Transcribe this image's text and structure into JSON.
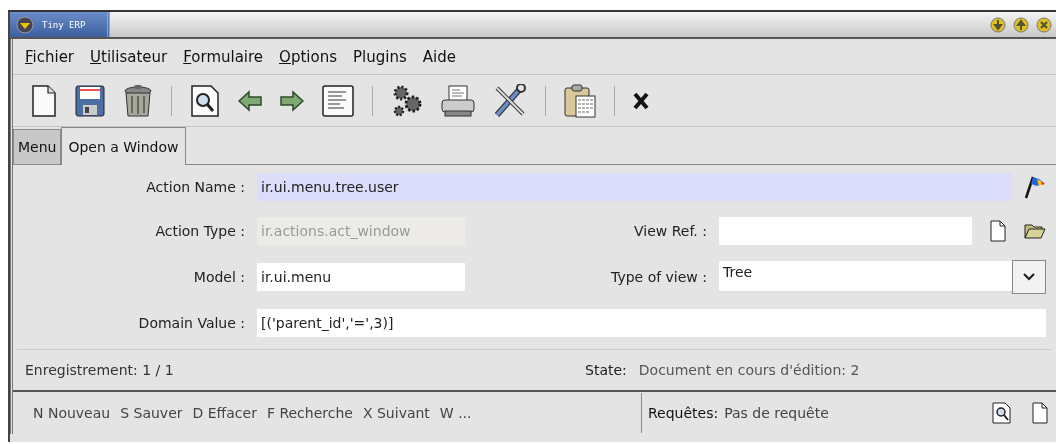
{
  "window": {
    "title": "Tiny ERP"
  },
  "menu": [
    {
      "label": "Fichier",
      "mnemonic": true
    },
    {
      "label": "Utilisateur",
      "mnemonic": true
    },
    {
      "label": "Formulaire",
      "mnemonic": true
    },
    {
      "label": "Options",
      "mnemonic": true
    },
    {
      "label": "Plugins",
      "mnemonic": false
    },
    {
      "label": "Aide",
      "mnemonic": false
    }
  ],
  "tabs": [
    {
      "label": "Menu",
      "selected": false
    },
    {
      "label": "Open a Window",
      "selected": true
    }
  ],
  "form": {
    "rows": [
      {
        "fields": [
          {
            "label": "Action Name :",
            "value": "ir.ui.menu.tree.user",
            "kind": "translatable",
            "focused": true,
            "disabled": false
          }
        ]
      },
      {
        "fields": [
          {
            "label": "Action Type :",
            "value": "ir.actions.act_window",
            "kind": "text",
            "focused": false,
            "disabled": true
          },
          {
            "label": "View Ref. :",
            "kind": "reference",
            "focused": false,
            "disabled": false
          }
        ]
      },
      {
        "fields": [
          {
            "label": "Model :",
            "value": "ir.ui.menu",
            "kind": "text",
            "focused": false,
            "disabled": false
          },
          {
            "label": "Type of view :",
            "value": "Tree",
            "kind": "selection",
            "focused": false,
            "disabled": false
          }
        ]
      },
      {
        "fields": [
          {
            "label": "Domain Value :",
            "value": "[('parent_id','=',3)]",
            "kind": "text",
            "focused": false,
            "disabled": false
          }
        ]
      }
    ]
  },
  "status": {
    "record": "Enregistrement: 1 / 1",
    "state_label": "State:",
    "state_value": "Document en cours d'édition: 2"
  },
  "shortcuts": [
    "N Nouveau",
    "S Sauver",
    "D Effacer",
    "F Recherche",
    "X Suivant",
    "W ..."
  ],
  "requests": {
    "label": "Requêtes:",
    "value": "Pas de requête"
  }
}
